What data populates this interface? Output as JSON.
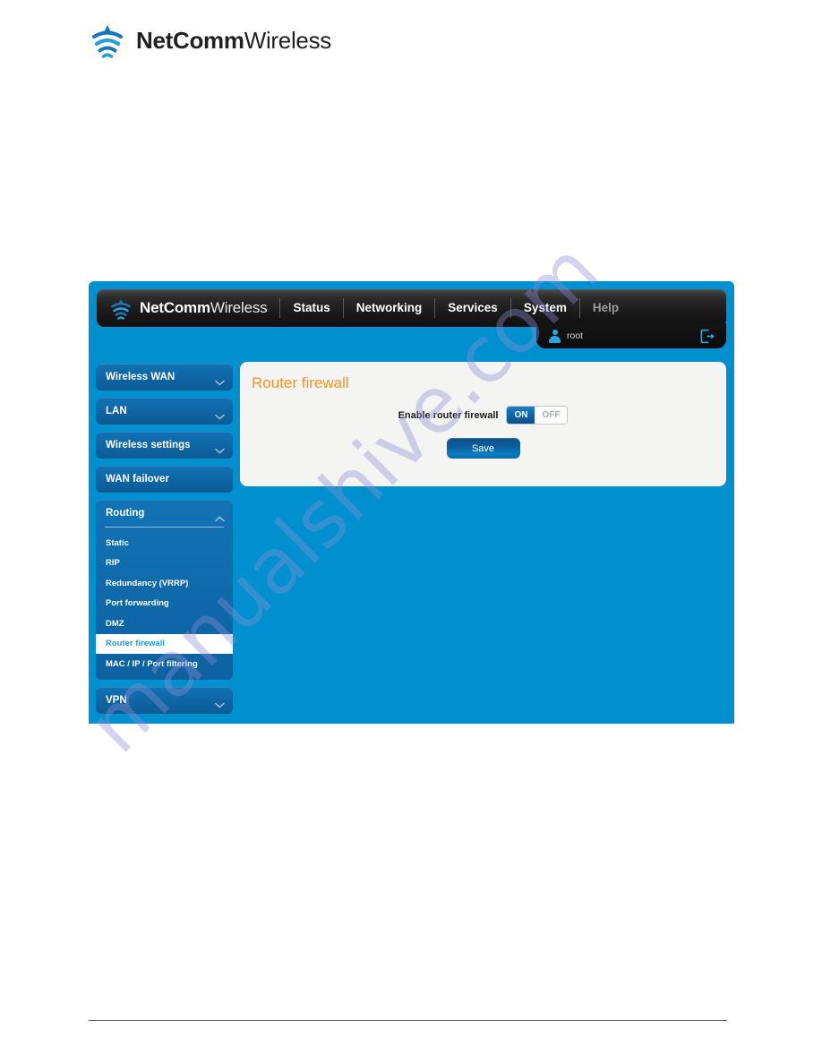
{
  "document": {
    "logo": {
      "icon": "netcomm-wave-icon",
      "bold_part": "NetComm",
      "light_part": "Wireless"
    }
  },
  "watermark": {
    "text": "manualshive.com",
    "color": "#8d8ed6"
  },
  "ui": {
    "background_color": "#0090cf",
    "header": {
      "logo": {
        "icon": "netcomm-wave-icon",
        "bold_part": "NetComm",
        "light_part": "Wireless"
      },
      "nav": [
        {
          "label": "Status",
          "dim": false
        },
        {
          "label": "Networking",
          "dim": false
        },
        {
          "label": "Services",
          "dim": false
        },
        {
          "label": "System",
          "dim": false
        },
        {
          "label": "Help",
          "dim": true
        }
      ]
    },
    "userbar": {
      "user_icon": "user-icon",
      "username": "root",
      "logout_icon": "logout-icon"
    },
    "sidebar": {
      "items": [
        {
          "label": "Wireless WAN",
          "chevron": "chevron-down-icon",
          "expanded": false
        },
        {
          "label": "LAN",
          "chevron": "chevron-down-icon",
          "expanded": false
        },
        {
          "label": "Wireless settings",
          "chevron": "chevron-down-icon",
          "expanded": false
        },
        {
          "label": "WAN failover",
          "chevron": "",
          "expanded": false
        }
      ],
      "routing": {
        "label": "Routing",
        "chevron": "chevron-up-icon",
        "expanded": true,
        "subitems": [
          {
            "label": "Static",
            "active": false
          },
          {
            "label": "RIP",
            "active": false
          },
          {
            "label": "Redundancy (VRRP)",
            "active": false
          },
          {
            "label": "Port forwarding",
            "active": false
          },
          {
            "label": "DMZ",
            "active": false
          },
          {
            "label": "Router firewall",
            "active": true
          },
          {
            "label": "MAC / IP / Port filtering",
            "active": false
          }
        ]
      },
      "vpn": {
        "label": "VPN",
        "chevron": "chevron-down-icon",
        "expanded": false
      }
    },
    "panel": {
      "title": "Router firewall",
      "title_color": "#f39325",
      "field_label": "Enable router firewall",
      "toggle": {
        "on_label": "ON",
        "off_label": "OFF",
        "value": "ON"
      },
      "save_label": "Save"
    }
  }
}
